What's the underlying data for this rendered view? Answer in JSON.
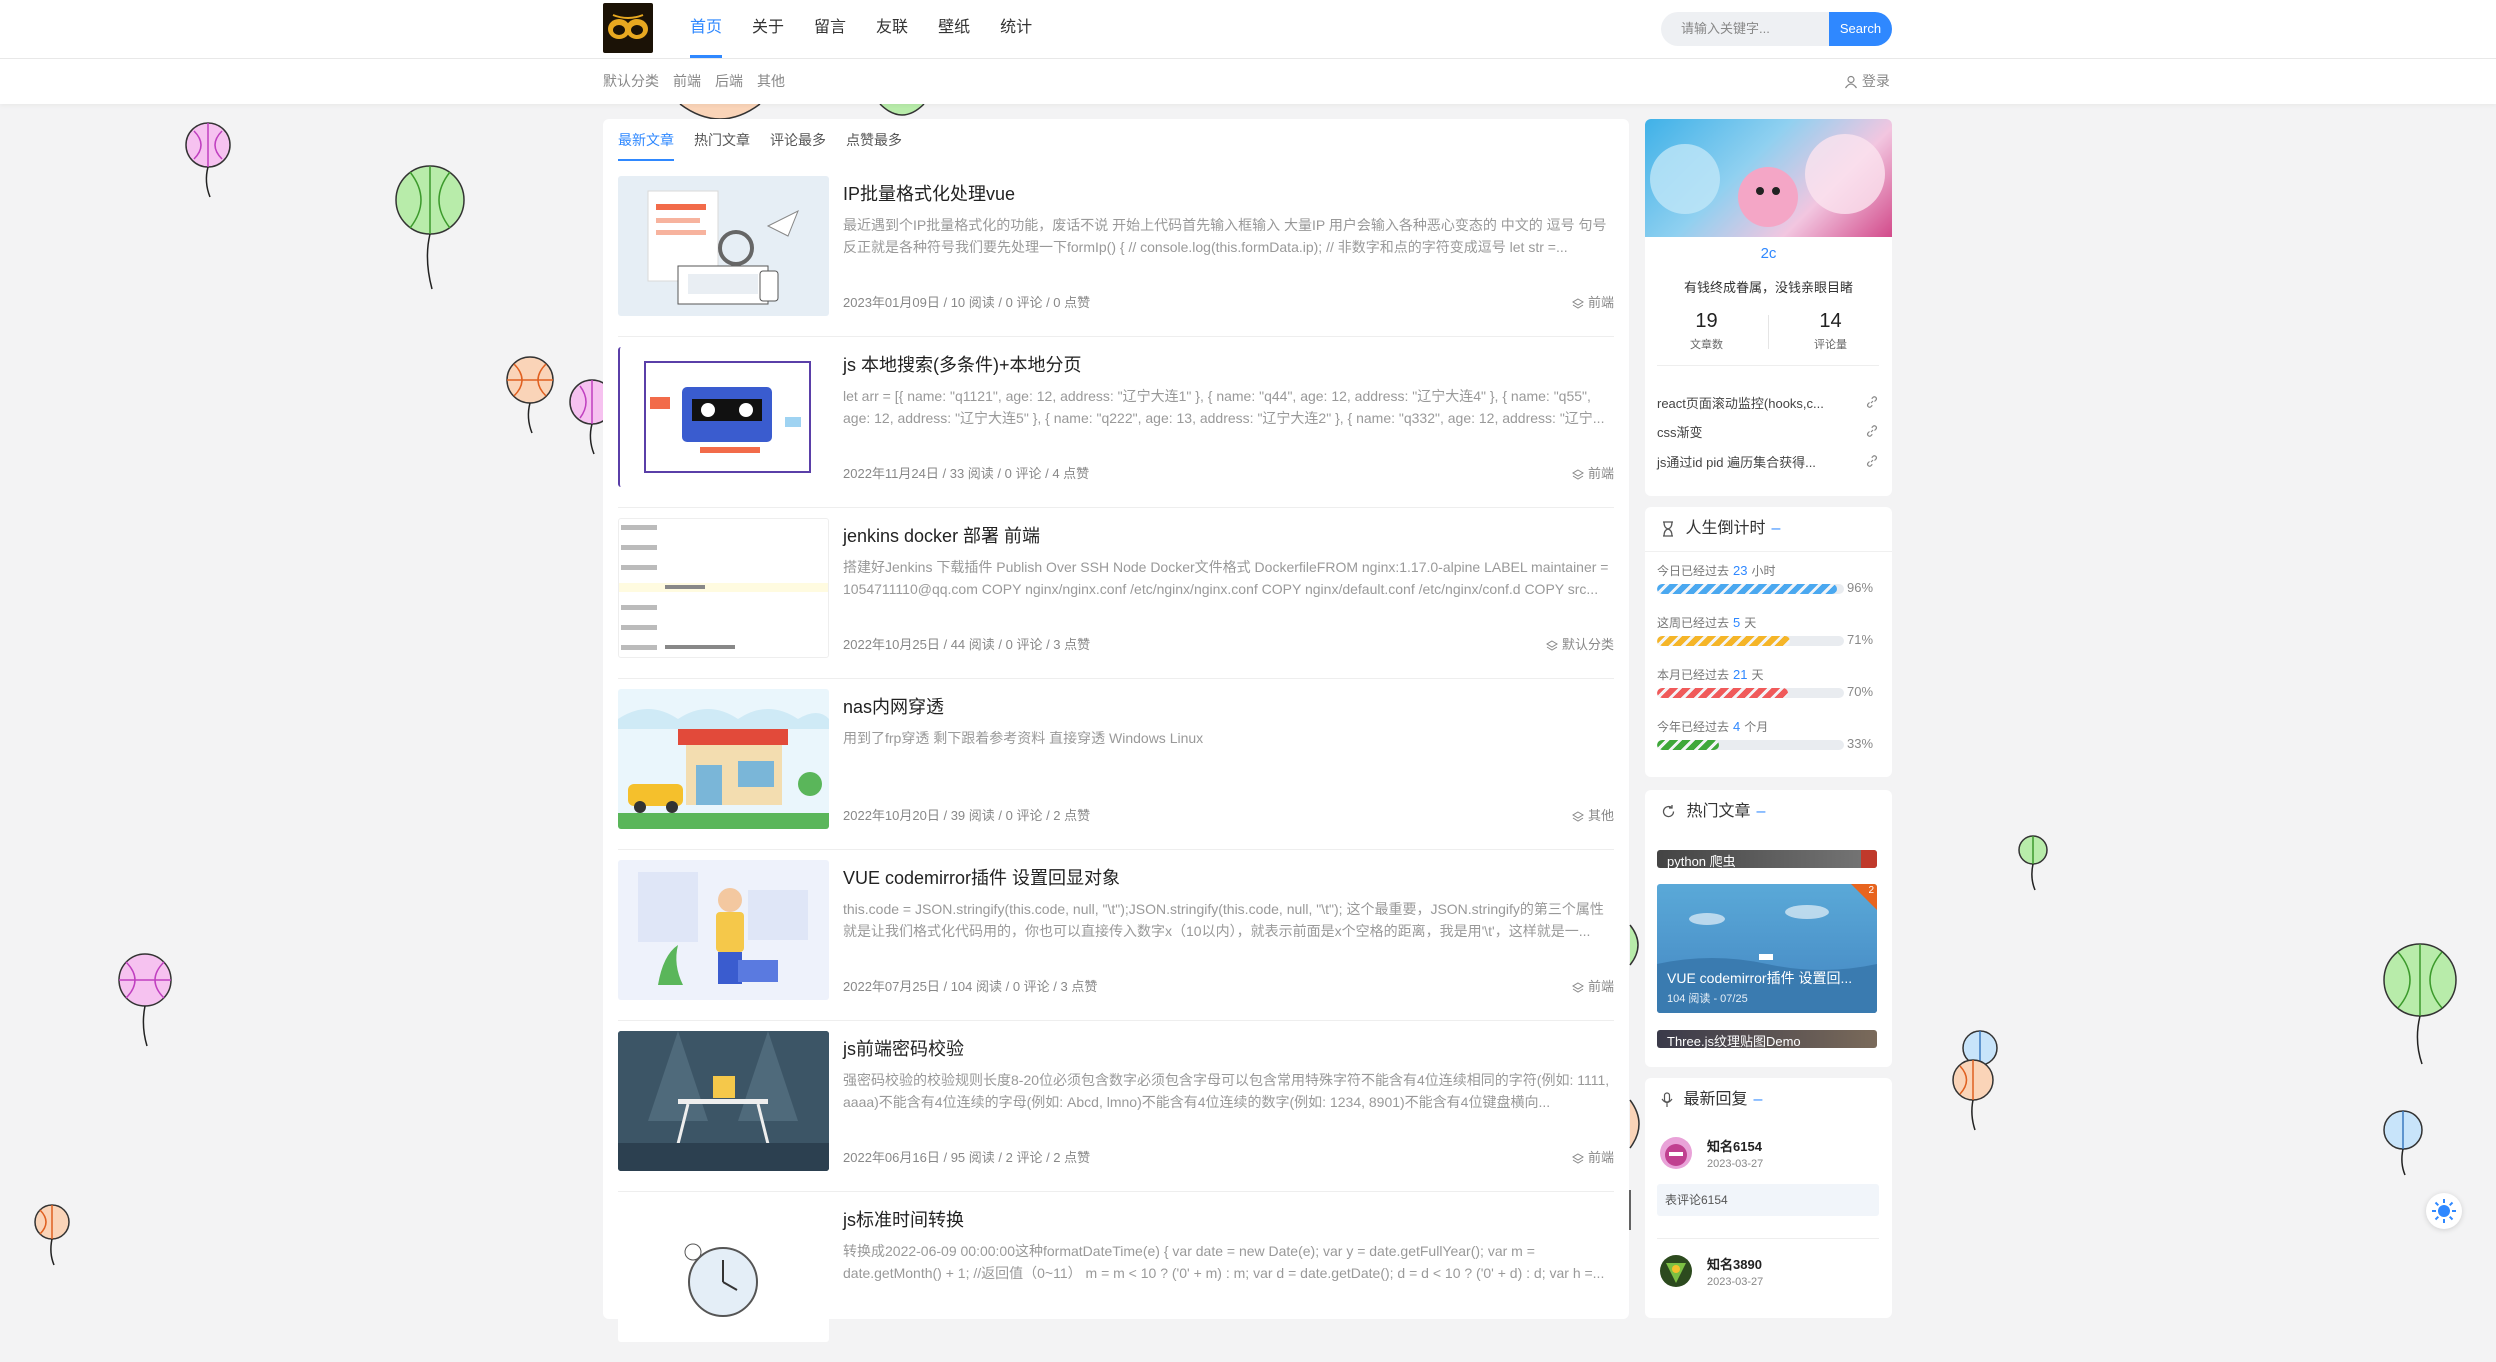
{
  "header": {
    "nav": [
      "首页",
      "关于",
      "留言",
      "友联",
      "壁纸",
      "统计"
    ],
    "active_nav": "首页",
    "search_placeholder": "请输入关键字...",
    "search_button": "Search",
    "subnav": [
      "默认分类",
      "前端",
      "后端",
      "其他"
    ],
    "login": "登录"
  },
  "tabs": [
    "最新文章",
    "热门文章",
    "评论最多",
    "点赞最多"
  ],
  "articles": [
    {
      "title": "IP批量格式化处理vue",
      "desc": "最近遇到个IP批量格式化的功能，废话不说 开始上代码首先输入框输入 大量IP 用户会输入各种恶心变态的 中文的 逗号 句号 反正就是各种符号我们要先处理一下formIp() { // console.log(this.formData.ip); // 非数字和点的字符变成逗号 let str =...",
      "date": "2023年01月09日",
      "reads": "10 阅读",
      "comments": "0 评论",
      "likes": "0 点赞",
      "category": "前端"
    },
    {
      "title": "js 本地搜索(多条件)+本地分页",
      "desc": "let arr = [{ name: \"q1121\", age: 12, address: \"辽宁大连1\" }, { name: \"q44\", age: 12, address: \"辽宁大连4\" }, { name: \"q55\", age: 12, address: \"辽宁大连5\" }, { name: \"q222\", age: 13, address: \"辽宁大连2\" }, { name: \"q332\", age: 12, address: \"辽宁...",
      "date": "2022年11月24日",
      "reads": "33 阅读",
      "comments": "0 评论",
      "likes": "4 点赞",
      "category": "前端"
    },
    {
      "title": "jenkins docker 部署 前端",
      "desc": "搭建好Jenkins 下载插件 Publish Over SSH Node Docker文件格式 DockerfileFROM nginx:1.17.0-alpine LABEL maintainer = 1054711110@qq.com COPY nginx/nginx.conf /etc/nginx/nginx.conf COPY nginx/default.conf /etc/nginx/conf.d COPY src...",
      "date": "2022年10月25日",
      "reads": "44 阅读",
      "comments": "0 评论",
      "likes": "3 点赞",
      "category": "默认分类"
    },
    {
      "title": "nas内网穿透",
      "desc": "用到了frp穿透 剩下跟着参考资料 直接穿透 Windows Linux",
      "date": "2022年10月20日",
      "reads": "39 阅读",
      "comments": "0 评论",
      "likes": "2 点赞",
      "category": "其他"
    },
    {
      "title": "VUE codemirror插件 设置回显对象",
      "desc": "this.code = JSON.stringify(this.code, null, \"\\t\");JSON.stringify(this.code, null, \"\\t\"); 这个最重要，JSON.stringify的第三个属性就是让我们格式化代码用的，你也可以直接传入数字x（10以内），就表示前面是x个空格的距离，我是用'\\t'，这样就是一...",
      "date": "2022年07月25日",
      "reads": "104 阅读",
      "comments": "0 评论",
      "likes": "3 点赞",
      "category": "前端"
    },
    {
      "title": "js前端密码校验",
      "desc": "强密码校验的校验规则长度8-20位必须包含数字必须包含字母可以包含常用特殊字符不能含有4位连续相同的字符(例如: 1111, aaaa)不能含有4位连续的字母(例如: Abcd, lmno)不能含有4位连续的数字(例如: 1234, 8901)不能含有4位键盘横向...",
      "date": "2022年06月16日",
      "reads": "95 阅读",
      "comments": "2 评论",
      "likes": "2 点赞",
      "category": "前端"
    },
    {
      "title": "js标准时间转换",
      "desc": "转换成2022-06-09 00:00:00这种formatDateTime(e) { var date = new Date(e); var y = date.getFullYear(); var m = date.getMonth() + 1; //返回值（0~11）  m = m < 10 ? ('0' + m) : m; var d = date.getDate(); d = d < 10 ? ('0' + d) : d; var h =...",
      "date": "",
      "reads": "",
      "comments": "",
      "likes": "",
      "category": ""
    }
  ],
  "profile": {
    "name": "2c",
    "motto": "有钱终成眷属，没钱亲眼目睹",
    "posts_count": "19",
    "posts_label": "文章数",
    "comments_count": "14",
    "comments_label": "评论量",
    "links": [
      "react页面滚动监控(hooks,c...",
      "css渐变",
      "js通过id pid 遍历集合获得..."
    ]
  },
  "countdown": {
    "title": "人生倒计时",
    "rows": [
      {
        "prefix": "今日已经过去",
        "value": "23",
        "unit": "小时",
        "pct": "96%",
        "fraction": 0.96,
        "color": "#4aa8f0"
      },
      {
        "prefix": "这周已经过去",
        "value": "5",
        "unit": "天",
        "pct": "71%",
        "fraction": 0.71,
        "color": "#f5b528"
      },
      {
        "prefix": "本月已经过去",
        "value": "21",
        "unit": "天",
        "pct": "70%",
        "fraction": 0.7,
        "color": "#f05a5a"
      },
      {
        "prefix": "今年已经过去",
        "value": "4",
        "unit": "个月",
        "pct": "33%",
        "fraction": 0.33,
        "color": "#3fa83a"
      }
    ]
  },
  "hot": {
    "title": "热门文章",
    "items": [
      {
        "title": "python 爬虫"
      },
      {
        "title": "VUE codemirror插件 设置回...",
        "meta": "104 阅读 - 07/25",
        "rank": "2"
      },
      {
        "title": "Three.js纹理贴图Demo"
      }
    ]
  },
  "replies": {
    "title": "最新回复",
    "items": [
      {
        "user": "知名6154",
        "date": "2023-03-27",
        "content": "表评论6154"
      },
      {
        "user": "知名3890",
        "date": "2023-03-27"
      }
    ]
  },
  "colors": {
    "accent": "#2f88ff",
    "background": "#f3f3f4"
  }
}
